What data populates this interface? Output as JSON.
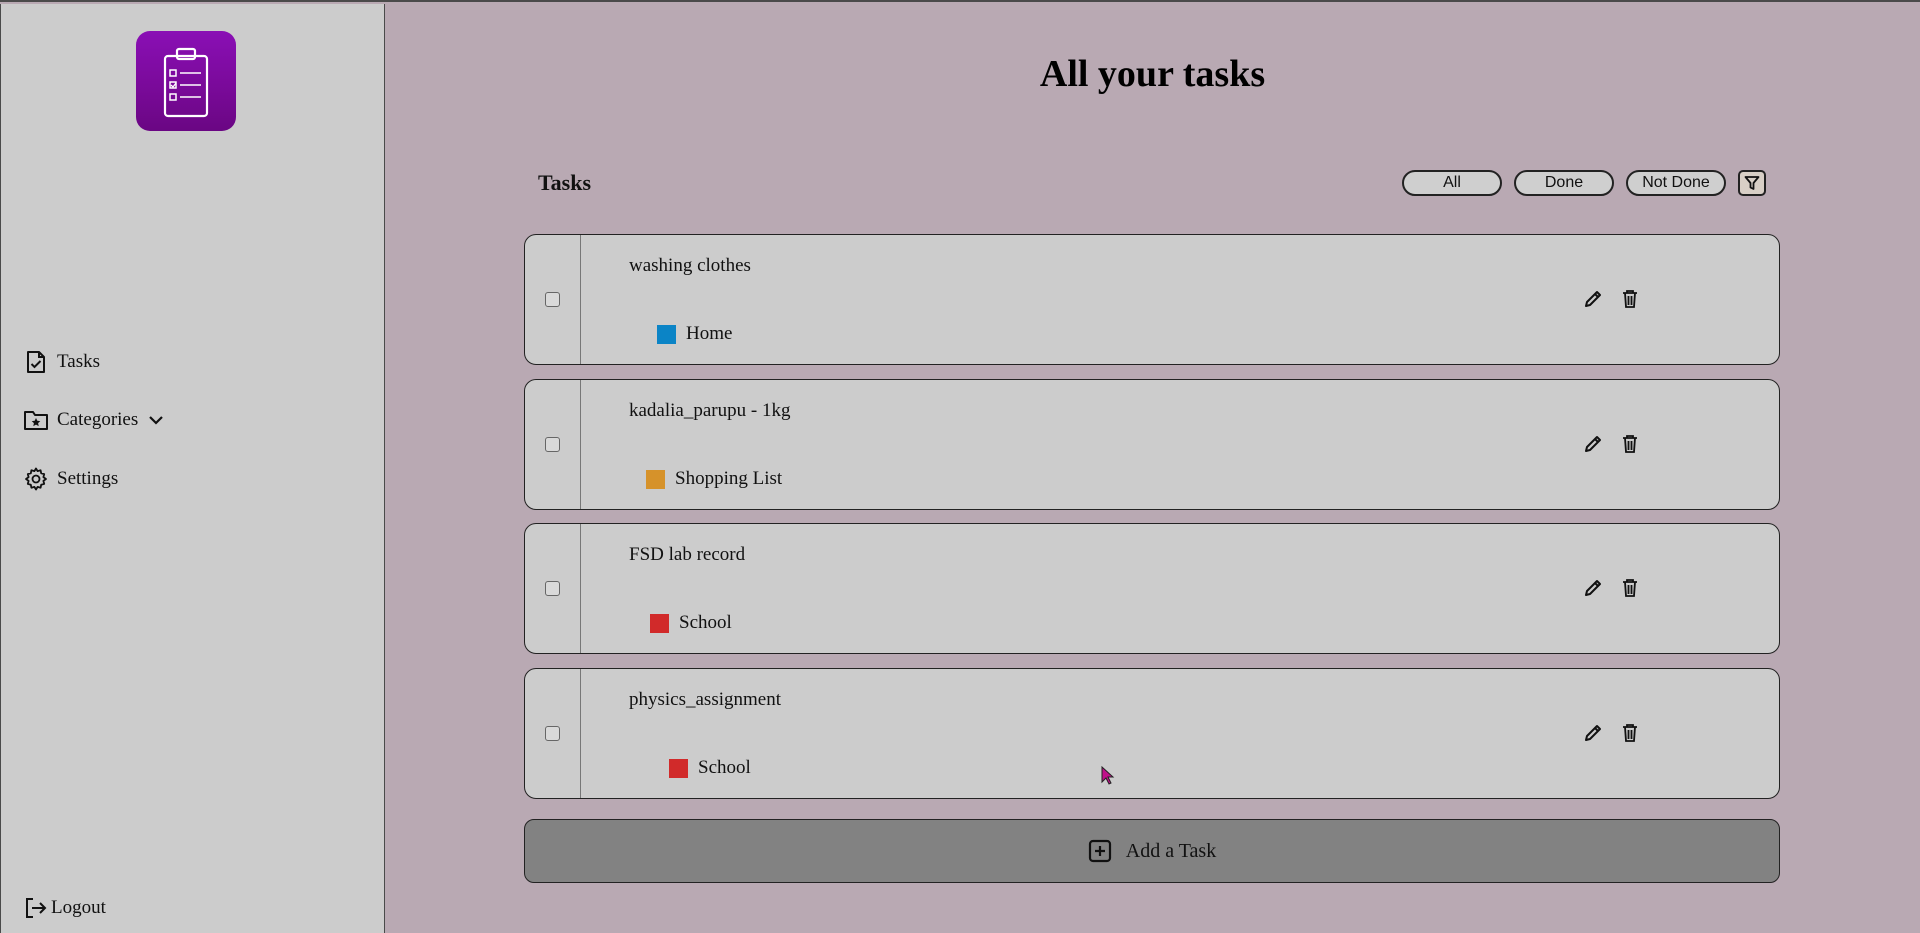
{
  "page": {
    "title": "All your tasks"
  },
  "sidebar": {
    "logo_icon": "clipboard-checklist-icon",
    "items": [
      {
        "label": "Tasks",
        "icon": "file-check-icon"
      },
      {
        "label": "Categories",
        "icon": "folder-star-icon"
      },
      {
        "label": "Settings",
        "icon": "gear-icon"
      }
    ],
    "logout_label": "Logout"
  },
  "tasks_header": {
    "label": "Tasks",
    "filters": [
      "All",
      "Done",
      "Not Done"
    ],
    "filter_icon": "funnel-icon"
  },
  "tasks": [
    {
      "title": "washing clothes",
      "category": "Home",
      "color": "#0b84c6",
      "done": false
    },
    {
      "title": "kadalia_parupu - 1kg",
      "category": "Shopping List",
      "color": "#d6922a",
      "done": false
    },
    {
      "title": "FSD lab record",
      "category": "School",
      "color": "#d12a2a",
      "done": false
    },
    {
      "title": "physics_assignment",
      "category": "School",
      "color": "#d12a2a",
      "done": false
    }
  ],
  "add_task": {
    "label": "Add a Task",
    "icon": "plus-square-icon"
  },
  "colors": {
    "background": "#b9a9b3",
    "sidebar": "#cccccc",
    "logo": "#7a0a9a",
    "add_button": "#828282"
  }
}
